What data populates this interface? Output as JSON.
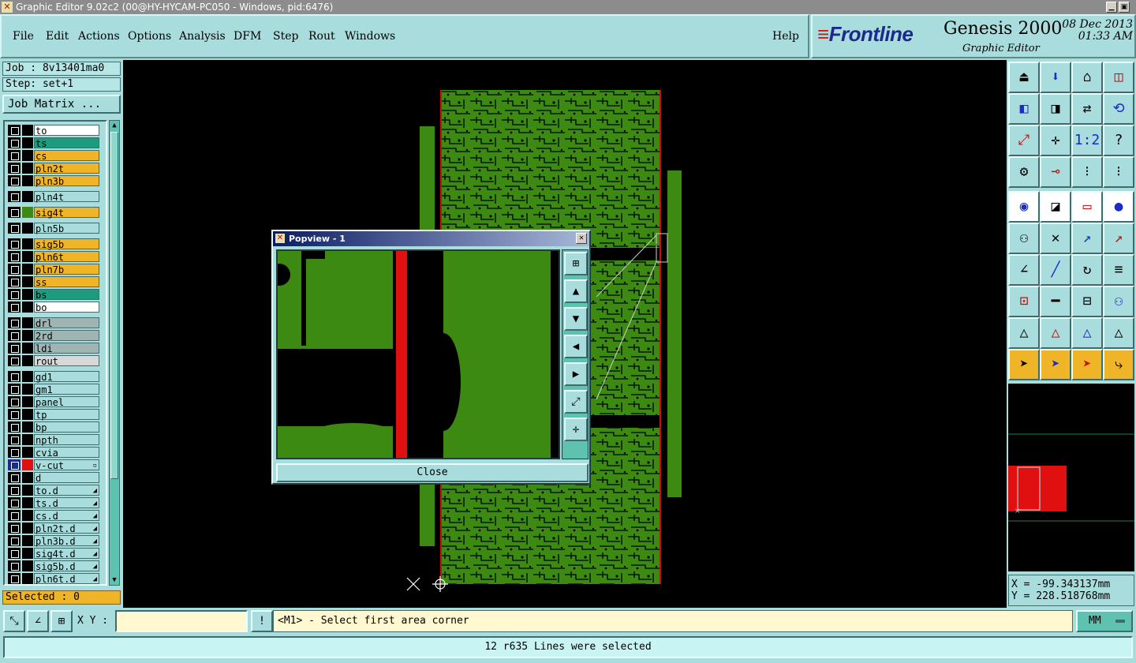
{
  "window": {
    "title": "Graphic Editor 9.02c2 (00@HY-HYCAM-PC050 - Windows, pid:6476)"
  },
  "menu": [
    "File",
    "Edit",
    "Actions",
    "Options",
    "Analysis",
    "DFM",
    "Step",
    "Rout",
    "Windows"
  ],
  "help": "Help",
  "brand": {
    "logo": "Frontline",
    "product": "Genesis 2000",
    "subtitle": "Graphic Editor",
    "date": "08 Dec 2013",
    "time": "01:33 AM"
  },
  "job": {
    "job_label": "Job : 8v13401ma0",
    "step_label": "Step: set+1",
    "matrix_button": "Job Matrix ..."
  },
  "layers": [
    {
      "name": "to",
      "color": "#ffffff"
    },
    {
      "name": "ts",
      "color": "#1c9c7c"
    },
    {
      "name": "cs",
      "color": "#f0b428"
    },
    {
      "name": "pln2t",
      "color": "#f0b428"
    },
    {
      "name": "pln3b",
      "color": "#f0b428"
    },
    {
      "name": "pln4t",
      "color": "#a9dcdc"
    },
    {
      "name": "sig4t",
      "color": "#f0b428",
      "active": true
    },
    {
      "name": "pln5b",
      "color": "#a9dcdc"
    },
    {
      "name": "sig5b",
      "color": "#f0b428"
    },
    {
      "name": "pln6t",
      "color": "#f0b428"
    },
    {
      "name": "pln7b",
      "color": "#f0b428"
    },
    {
      "name": "ss",
      "color": "#f0b428"
    },
    {
      "name": "bs",
      "color": "#1c9c7c"
    },
    {
      "name": "bo",
      "color": "#ffffff"
    },
    {
      "name": "drl",
      "color": "#a0b4b4"
    },
    {
      "name": "2rd",
      "color": "#a0b4b4"
    },
    {
      "name": "ldi",
      "color": "#a0b4b4"
    },
    {
      "name": "rout",
      "color": "#d8d8d8"
    },
    {
      "name": "gd1",
      "color": "#a9dcdc"
    },
    {
      "name": "gm1",
      "color": "#a9dcdc"
    },
    {
      "name": "panel",
      "color": "#a9dcdc"
    },
    {
      "name": "tp",
      "color": "#a9dcdc"
    },
    {
      "name": "bp",
      "color": "#a9dcdc"
    },
    {
      "name": "npth",
      "color": "#a9dcdc"
    },
    {
      "name": "cvia",
      "color": "#a9dcdc"
    },
    {
      "name": "v-cut",
      "color": "#a9dcdc",
      "work": true
    },
    {
      "name": "d",
      "color": "#a9dcdc"
    },
    {
      "name": "to.d",
      "color": "#a9dcdc"
    },
    {
      "name": "ts.d",
      "color": "#a9dcdc"
    },
    {
      "name": "cs.d",
      "color": "#a9dcdc"
    },
    {
      "name": "pln2t.d",
      "color": "#a9dcdc"
    },
    {
      "name": "pln3b.d",
      "color": "#a9dcdc"
    },
    {
      "name": "sig4t.d",
      "color": "#a9dcdc"
    },
    {
      "name": "sig5b.d",
      "color": "#a9dcdc"
    },
    {
      "name": "pln6t.d",
      "color": "#a9dcdc"
    }
  ],
  "selected": "Selected : 0",
  "popview": {
    "title": "Popview - 1",
    "close_button": "Close"
  },
  "coords": {
    "x": "X = -99.343137mm",
    "y": "Y = 228.518768mm"
  },
  "command": {
    "xy_label": "X Y :",
    "xy_value": "",
    "prompt": "<M1> - Select first area corner",
    "units": "MM"
  },
  "status": "12 r635 Lines were selected",
  "toolbox_icons": [
    "zoom-home-icon",
    "zoom-down-icon",
    "home-icon",
    "window-icon",
    "pan-left-icon",
    "pan-right-icon",
    "flip-icon",
    "redraw-icon",
    "fit-icon",
    "zoom-in-icon",
    "scale-1-2-icon",
    "query-icon",
    "tools-icon",
    "feature-icon",
    "netlist-icon",
    "netlist-red-icon",
    "snap-icon",
    "profile-icon",
    "ruler-icon",
    "pad-icon",
    "connect-icon",
    "cross-icon",
    "move-point-icon",
    "move-red-icon",
    "line-icon",
    "slash-icon",
    "arc-icon",
    "text-icon",
    "pad-add-icon",
    "split-icon",
    "measure-icon",
    "group-icon",
    "triangle-icon",
    "triangle-blue-icon",
    "triangle-flat-icon",
    "triangle-cut-icon",
    "select-icon",
    "select-box-icon",
    "select-polygon-icon",
    "route-icon"
  ]
}
